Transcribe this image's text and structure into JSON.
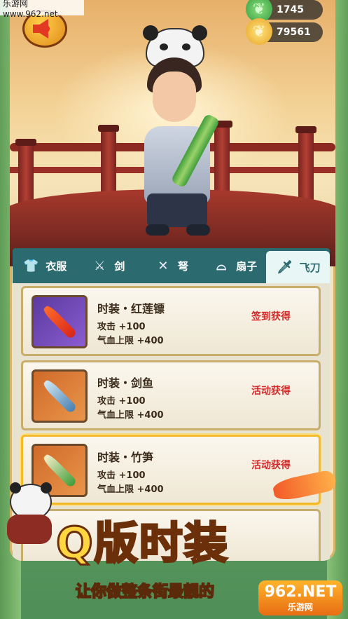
{
  "watermark": "乐游网 www.962.net",
  "hud": {
    "jade_value": "1745",
    "gold_value": "79561",
    "jade_icon": "jade-leaf-icon",
    "gold_icon": "gold-ingot-icon"
  },
  "tabs": [
    {
      "label": "衣服",
      "icon": "clothes-icon"
    },
    {
      "label": "剑",
      "icon": "sword-icon"
    },
    {
      "label": "弩",
      "icon": "crossbow-icon"
    },
    {
      "label": "扇子",
      "icon": "fan-icon"
    },
    {
      "label": "飞刀",
      "icon": "dagger-icon",
      "active": true
    }
  ],
  "items": [
    {
      "name": "时装・红莲镖",
      "stat1": "攻击 +100",
      "stat2": "气血上限 +400",
      "source": "签到获得",
      "thumb": "purple"
    },
    {
      "name": "时装・剑鱼",
      "stat1": "攻击 +100",
      "stat2": "气血上限 +400",
      "source": "活动获得",
      "thumb": "orange"
    },
    {
      "name": "时装・竹笋",
      "stat1": "攻击 +100",
      "stat2": "气血上限 +400",
      "source": "活动获得",
      "thumb": "orange"
    }
  ],
  "promo": {
    "title": "Q版时装",
    "slogan": "让你做整条街最靓的",
    "brand_big": "962.NET",
    "brand_small": "乐游网"
  },
  "colors": {
    "tab_bar": "#2b6a6e",
    "source_text": "#d42a2a",
    "card_border": "#c9ad6a"
  }
}
